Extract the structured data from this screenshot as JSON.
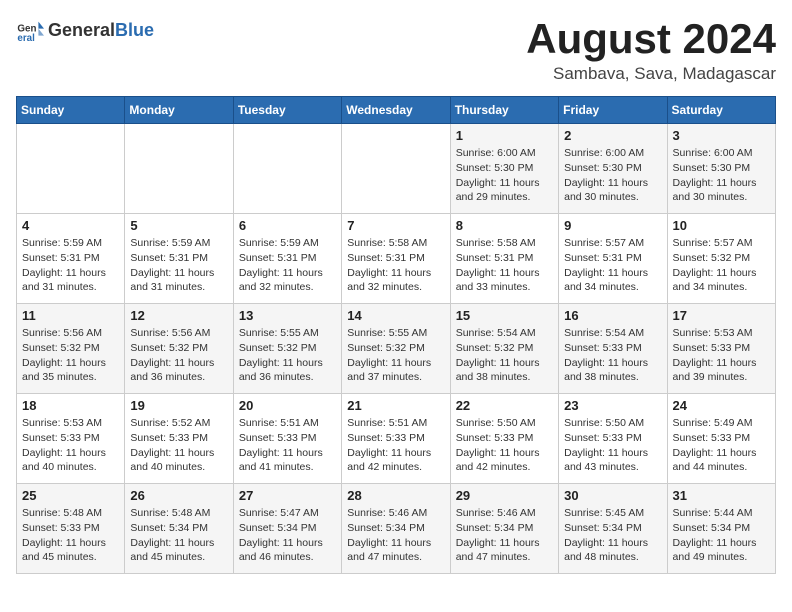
{
  "header": {
    "logo_general": "General",
    "logo_blue": "Blue",
    "month_year": "August 2024",
    "location": "Sambava, Sava, Madagascar"
  },
  "weekdays": [
    "Sunday",
    "Monday",
    "Tuesday",
    "Wednesday",
    "Thursday",
    "Friday",
    "Saturday"
  ],
  "weeks": [
    [
      {
        "day": "",
        "info": ""
      },
      {
        "day": "",
        "info": ""
      },
      {
        "day": "",
        "info": ""
      },
      {
        "day": "",
        "info": ""
      },
      {
        "day": "1",
        "info": "Sunrise: 6:00 AM\nSunset: 5:30 PM\nDaylight: 11 hours\nand 29 minutes."
      },
      {
        "day": "2",
        "info": "Sunrise: 6:00 AM\nSunset: 5:30 PM\nDaylight: 11 hours\nand 30 minutes."
      },
      {
        "day": "3",
        "info": "Sunrise: 6:00 AM\nSunset: 5:30 PM\nDaylight: 11 hours\nand 30 minutes."
      }
    ],
    [
      {
        "day": "4",
        "info": "Sunrise: 5:59 AM\nSunset: 5:31 PM\nDaylight: 11 hours\nand 31 minutes."
      },
      {
        "day": "5",
        "info": "Sunrise: 5:59 AM\nSunset: 5:31 PM\nDaylight: 11 hours\nand 31 minutes."
      },
      {
        "day": "6",
        "info": "Sunrise: 5:59 AM\nSunset: 5:31 PM\nDaylight: 11 hours\nand 32 minutes."
      },
      {
        "day": "7",
        "info": "Sunrise: 5:58 AM\nSunset: 5:31 PM\nDaylight: 11 hours\nand 32 minutes."
      },
      {
        "day": "8",
        "info": "Sunrise: 5:58 AM\nSunset: 5:31 PM\nDaylight: 11 hours\nand 33 minutes."
      },
      {
        "day": "9",
        "info": "Sunrise: 5:57 AM\nSunset: 5:31 PM\nDaylight: 11 hours\nand 34 minutes."
      },
      {
        "day": "10",
        "info": "Sunrise: 5:57 AM\nSunset: 5:32 PM\nDaylight: 11 hours\nand 34 minutes."
      }
    ],
    [
      {
        "day": "11",
        "info": "Sunrise: 5:56 AM\nSunset: 5:32 PM\nDaylight: 11 hours\nand 35 minutes."
      },
      {
        "day": "12",
        "info": "Sunrise: 5:56 AM\nSunset: 5:32 PM\nDaylight: 11 hours\nand 36 minutes."
      },
      {
        "day": "13",
        "info": "Sunrise: 5:55 AM\nSunset: 5:32 PM\nDaylight: 11 hours\nand 36 minutes."
      },
      {
        "day": "14",
        "info": "Sunrise: 5:55 AM\nSunset: 5:32 PM\nDaylight: 11 hours\nand 37 minutes."
      },
      {
        "day": "15",
        "info": "Sunrise: 5:54 AM\nSunset: 5:32 PM\nDaylight: 11 hours\nand 38 minutes."
      },
      {
        "day": "16",
        "info": "Sunrise: 5:54 AM\nSunset: 5:33 PM\nDaylight: 11 hours\nand 38 minutes."
      },
      {
        "day": "17",
        "info": "Sunrise: 5:53 AM\nSunset: 5:33 PM\nDaylight: 11 hours\nand 39 minutes."
      }
    ],
    [
      {
        "day": "18",
        "info": "Sunrise: 5:53 AM\nSunset: 5:33 PM\nDaylight: 11 hours\nand 40 minutes."
      },
      {
        "day": "19",
        "info": "Sunrise: 5:52 AM\nSunset: 5:33 PM\nDaylight: 11 hours\nand 40 minutes."
      },
      {
        "day": "20",
        "info": "Sunrise: 5:51 AM\nSunset: 5:33 PM\nDaylight: 11 hours\nand 41 minutes."
      },
      {
        "day": "21",
        "info": "Sunrise: 5:51 AM\nSunset: 5:33 PM\nDaylight: 11 hours\nand 42 minutes."
      },
      {
        "day": "22",
        "info": "Sunrise: 5:50 AM\nSunset: 5:33 PM\nDaylight: 11 hours\nand 42 minutes."
      },
      {
        "day": "23",
        "info": "Sunrise: 5:50 AM\nSunset: 5:33 PM\nDaylight: 11 hours\nand 43 minutes."
      },
      {
        "day": "24",
        "info": "Sunrise: 5:49 AM\nSunset: 5:33 PM\nDaylight: 11 hours\nand 44 minutes."
      }
    ],
    [
      {
        "day": "25",
        "info": "Sunrise: 5:48 AM\nSunset: 5:33 PM\nDaylight: 11 hours\nand 45 minutes."
      },
      {
        "day": "26",
        "info": "Sunrise: 5:48 AM\nSunset: 5:34 PM\nDaylight: 11 hours\nand 45 minutes."
      },
      {
        "day": "27",
        "info": "Sunrise: 5:47 AM\nSunset: 5:34 PM\nDaylight: 11 hours\nand 46 minutes."
      },
      {
        "day": "28",
        "info": "Sunrise: 5:46 AM\nSunset: 5:34 PM\nDaylight: 11 hours\nand 47 minutes."
      },
      {
        "day": "29",
        "info": "Sunrise: 5:46 AM\nSunset: 5:34 PM\nDaylight: 11 hours\nand 47 minutes."
      },
      {
        "day": "30",
        "info": "Sunrise: 5:45 AM\nSunset: 5:34 PM\nDaylight: 11 hours\nand 48 minutes."
      },
      {
        "day": "31",
        "info": "Sunrise: 5:44 AM\nSunset: 5:34 PM\nDaylight: 11 hours\nand 49 minutes."
      }
    ]
  ]
}
